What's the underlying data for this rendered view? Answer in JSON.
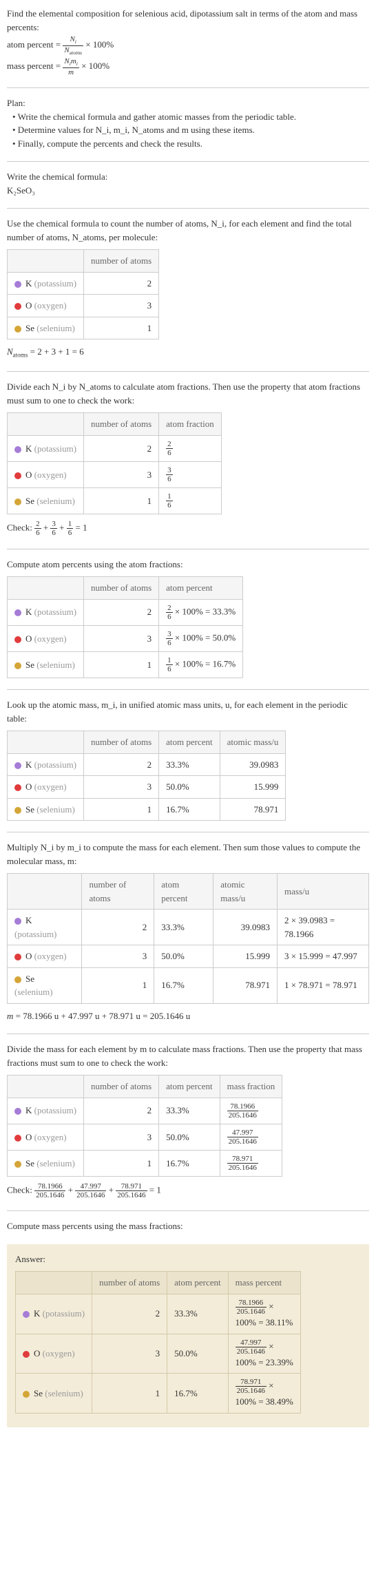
{
  "intro": {
    "line1": "Find the elemental composition for selenious acid, dipotassium salt in terms of the atom and mass percents:",
    "atom_percent_label": "atom percent =",
    "atom_percent_frac_num": "N_i",
    "atom_percent_frac_den": "N_atoms",
    "times100a": "× 100%",
    "mass_percent_label": "mass percent =",
    "mass_percent_frac_num": "N_i m_i",
    "mass_percent_frac_den": "m",
    "times100b": "× 100%"
  },
  "plan": {
    "heading": "Plan:",
    "item1": "• Write the chemical formula and gather atomic masses from the periodic table.",
    "item2": "• Determine values for N_i, m_i, N_atoms and m using these items.",
    "item3": "• Finally, compute the percents and check the results."
  },
  "formula_section": {
    "heading": "Write the chemical formula:",
    "formula": "K₂SeO₃"
  },
  "count_section": {
    "heading": "Use the chemical formula to count the number of atoms, N_i, for each element and find the total number of atoms, N_atoms, per molecule:",
    "col_atoms": "number of atoms",
    "k_label": "K (potassium)",
    "k_n": "2",
    "o_label": "O (oxygen)",
    "o_n": "3",
    "se_label": "Se (selenium)",
    "se_n": "1",
    "total": "N_atoms = 2 + 3 + 1 = 6"
  },
  "atomfrac_section": {
    "heading": "Divide each N_i by N_atoms to calculate atom fractions. Then use the property that atom fractions must sum to one to check the work:",
    "col_atoms": "number of atoms",
    "col_frac": "atom fraction",
    "k_n": "2",
    "k_frac_num": "2",
    "k_frac_den": "6",
    "o_n": "3",
    "o_frac_num": "3",
    "o_frac_den": "6",
    "se_n": "1",
    "se_frac_num": "1",
    "se_frac_den": "6",
    "check": "Check: ",
    "check_sum": " = 1"
  },
  "atompct_section": {
    "heading": "Compute atom percents using the atom fractions:",
    "col_atoms": "number of atoms",
    "col_pct": "atom percent",
    "k_n": "2",
    "k_pct": " × 100% = 33.3%",
    "o_n": "3",
    "o_pct": " × 100% = 50.0%",
    "se_n": "1",
    "se_pct": " × 100% = 16.7%"
  },
  "mass_section": {
    "heading": "Look up the atomic mass, m_i, in unified atomic mass units, u, for each element in the periodic table:",
    "col_atoms": "number of atoms",
    "col_pct": "atom percent",
    "col_mass": "atomic mass/u",
    "k_n": "2",
    "k_pct": "33.3%",
    "k_m": "39.0983",
    "o_n": "3",
    "o_pct": "50.0%",
    "o_m": "15.999",
    "se_n": "1",
    "se_pct": "16.7%",
    "se_m": "78.971"
  },
  "mult_section": {
    "heading": "Multiply N_i by m_i to compute the mass for each element. Then sum those values to compute the molecular mass, m:",
    "col_atoms": "number of atoms",
    "col_pct": "atom percent",
    "col_mass": "atomic mass/u",
    "col_massu": "mass/u",
    "k_n": "2",
    "k_pct": "33.3%",
    "k_m": "39.0983",
    "k_mu": "2 × 39.0983 = 78.1966",
    "o_n": "3",
    "o_pct": "50.0%",
    "o_m": "15.999",
    "o_mu": "3 × 15.999 = 47.997",
    "se_n": "1",
    "se_pct": "16.7%",
    "se_m": "78.971",
    "se_mu": "1 × 78.971 = 78.971",
    "total": "m = 78.1966 u + 47.997 u + 78.971 u = 205.1646 u"
  },
  "massfrac_section": {
    "heading": "Divide the mass for each element by m to calculate mass fractions. Then use the property that mass fractions must sum to one to check the work:",
    "col_atoms": "number of atoms",
    "col_pct": "atom percent",
    "col_mfrac": "mass fraction",
    "k_n": "2",
    "k_pct": "33.3%",
    "k_mf_num": "78.1966",
    "k_mf_den": "205.1646",
    "o_n": "3",
    "o_pct": "50.0%",
    "o_mf_num": "47.997",
    "o_mf_den": "205.1646",
    "se_n": "1",
    "se_pct": "16.7%",
    "se_mf_num": "78.971",
    "se_mf_den": "205.1646",
    "check": "Check: ",
    "check_sum": " = 1"
  },
  "masspct_section": {
    "heading": "Compute mass percents using the mass fractions:"
  },
  "answer": {
    "heading": "Answer:",
    "col_atoms": "number of atoms",
    "col_pct": "atom percent",
    "col_mpct": "mass percent",
    "k_n": "2",
    "k_pct": "33.3%",
    "k_num": "78.1966",
    "k_den": "205.1646",
    "k_res": "100% = 38.11%",
    "o_n": "3",
    "o_pct": "50.0%",
    "o_num": "47.997",
    "o_den": "205.1646",
    "o_res": "100% = 23.39%",
    "se_n": "1",
    "se_pct": "16.7%",
    "se_num": "78.971",
    "se_den": "205.1646",
    "se_res": "100% = 38.49%"
  },
  "el": {
    "k": "K",
    "k_name": "(potassium)",
    "o": "O",
    "o_name": "(oxygen)",
    "se": "Se",
    "se_name": "(selenium)"
  }
}
